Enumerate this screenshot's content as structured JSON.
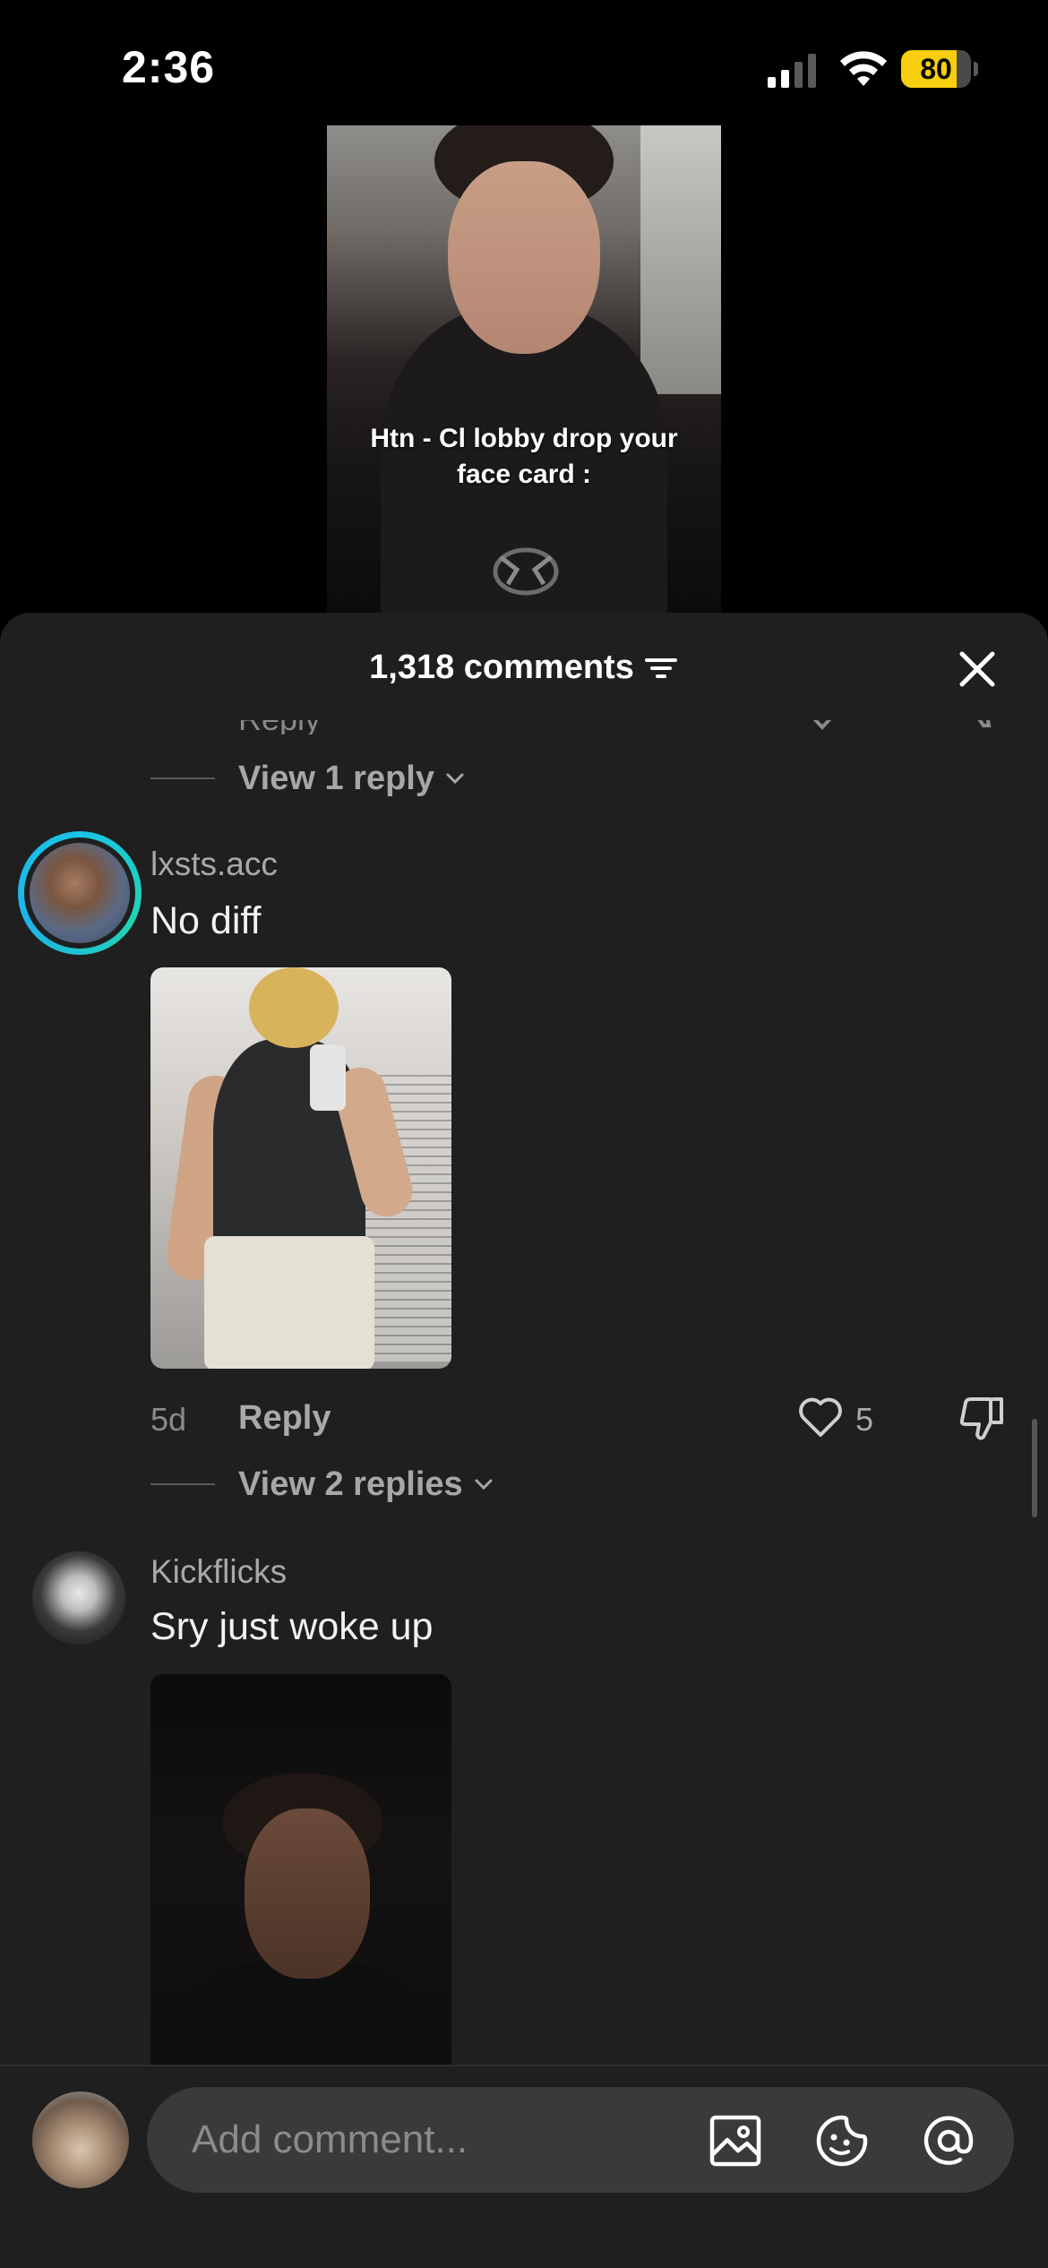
{
  "status_bar": {
    "time": "2:36",
    "battery": "80",
    "battery_level": 0.8
  },
  "video": {
    "caption_line1": "Htn - Cl lobby drop your",
    "caption_line2": "face card :"
  },
  "sheet": {
    "comment_count": "1,318 comments",
    "partial_row": {
      "text": "Reply"
    }
  },
  "replies_1": {
    "label": "View 1 reply"
  },
  "comments": [
    {
      "username": "lxsts.acc",
      "text": "No diff",
      "time": "5d",
      "reply_label": "Reply",
      "likes": "5",
      "view_replies": "View 2 replies"
    },
    {
      "username": "Kickflicks",
      "text": "Sry just woke up"
    }
  ],
  "input": {
    "placeholder": "Add comment..."
  },
  "icons": {
    "filter": "filter-icon",
    "close": "close-icon",
    "like": "heart-icon",
    "dislike": "thumbs-down-icon",
    "image": "image-icon",
    "sticker": "sticker-icon",
    "mention": "at-icon"
  },
  "colors": {
    "sheet_bg": "#1f1f1f",
    "battery": "#f7cf0f",
    "story_ring": "#19c4e5"
  }
}
